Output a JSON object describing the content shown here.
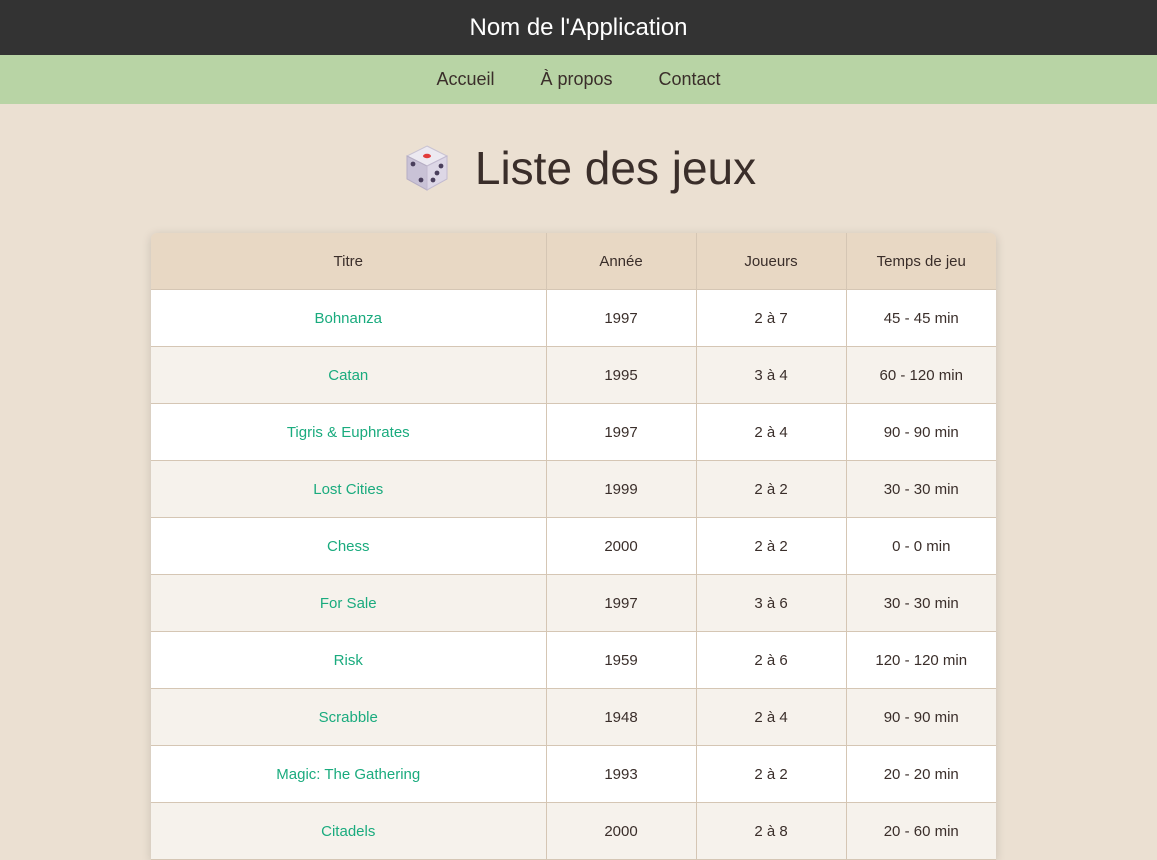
{
  "app": {
    "title": "Nom de l'Application"
  },
  "nav": {
    "items": [
      {
        "label": "Accueil"
      },
      {
        "label": "À propos"
      },
      {
        "label": "Contact"
      }
    ]
  },
  "page": {
    "title": "Liste des jeux",
    "title_icon": "dice-icon"
  },
  "table": {
    "headers": [
      "Titre",
      "Année",
      "Joueurs",
      "Temps de jeu"
    ],
    "rows": [
      {
        "title": "Bohnanza",
        "year": "1997",
        "players": "2 à 7",
        "time": "45 - 45 min"
      },
      {
        "title": "Catan",
        "year": "1995",
        "players": "3 à 4",
        "time": "60 - 120 min"
      },
      {
        "title": "Tigris & Euphrates",
        "year": "1997",
        "players": "2 à 4",
        "time": "90 - 90 min"
      },
      {
        "title": "Lost Cities",
        "year": "1999",
        "players": "2 à 2",
        "time": "30 - 30 min"
      },
      {
        "title": "Chess",
        "year": "2000",
        "players": "2 à 2",
        "time": "0 - 0 min"
      },
      {
        "title": "For Sale",
        "year": "1997",
        "players": "3 à 6",
        "time": "30 - 30 min"
      },
      {
        "title": "Risk",
        "year": "1959",
        "players": "2 à 6",
        "time": "120 - 120 min"
      },
      {
        "title": "Scrabble",
        "year": "1948",
        "players": "2 à 4",
        "time": "90 - 90 min"
      },
      {
        "title": "Magic: The Gathering",
        "year": "1993",
        "players": "2 à 2",
        "time": "20 - 20 min"
      },
      {
        "title": "Citadels",
        "year": "2000",
        "players": "2 à 8",
        "time": "20 - 60 min"
      }
    ]
  },
  "colors": {
    "header_bg": "#333333",
    "nav_bg": "#b8d4a5",
    "page_bg": "#ebe0d2",
    "table_header_bg": "#e8d8c4",
    "link": "#1aab7e"
  }
}
